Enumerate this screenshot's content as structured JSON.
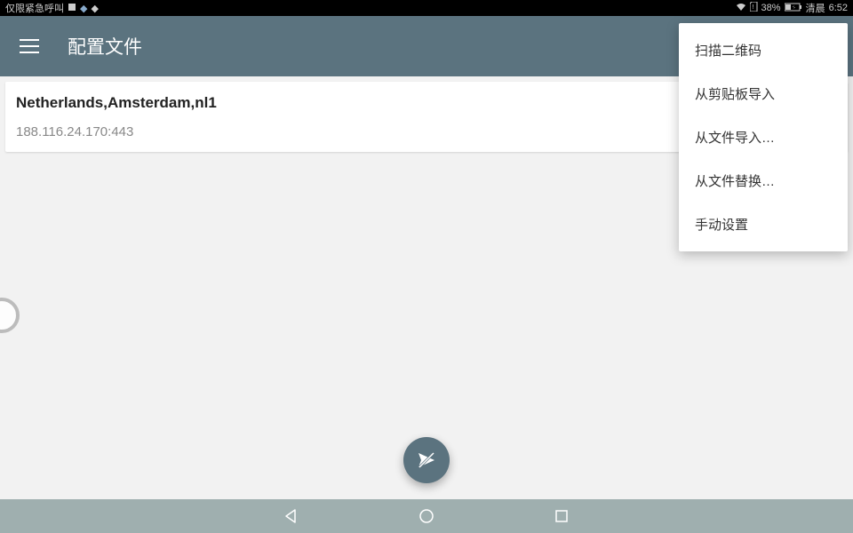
{
  "statusbar": {
    "left_text": "仅限紧急呼叫",
    "battery_pct": "38%",
    "time_prefix": "清晨",
    "time": "6:52"
  },
  "appbar": {
    "title": "配置文件"
  },
  "profiles": [
    {
      "title": "Netherlands,Amsterdam,nl1",
      "address": "188.116.24.170:443"
    }
  ],
  "menu": {
    "items": [
      "扫描二维码",
      "从剪贴板导入",
      "从文件导入…",
      "从文件替换…",
      "手动设置"
    ]
  }
}
